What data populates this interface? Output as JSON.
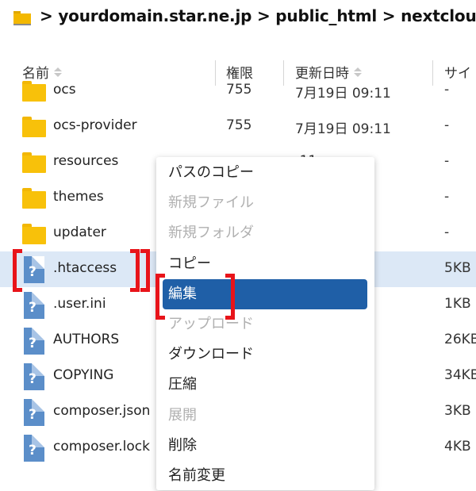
{
  "breadcrumb": {
    "path": "> yourdomain.star.ne.jp > public_html > nextcloud",
    "icon": "folder-icon"
  },
  "columns": {
    "name": "名前",
    "perm": "権限",
    "date": "更新日時",
    "size": "サイ"
  },
  "rows": [
    {
      "name": "ocs",
      "perm": "755",
      "date": "7月19日 09:11",
      "size": "-",
      "type": "folder"
    },
    {
      "name": "ocs-provider",
      "perm": "755",
      "date": "7月19日 09:11",
      "size": "-",
      "type": "folder"
    },
    {
      "name": "resources",
      "perm": "",
      "date": ":11",
      "size": "-",
      "type": "folder"
    },
    {
      "name": "themes",
      "perm": "",
      "date": ":11",
      "size": "-",
      "type": "folder"
    },
    {
      "name": "updater",
      "perm": "",
      "date": ":11",
      "size": "-",
      "type": "folder"
    },
    {
      "name": ".htaccess",
      "perm": "",
      "date": ":54",
      "size": "5KB",
      "type": "file",
      "selected": true
    },
    {
      "name": ".user.ini",
      "perm": "",
      "date": ":54",
      "size": "1KB",
      "type": "file"
    },
    {
      "name": "AUTHORS",
      "perm": "",
      "date": ":54",
      "size": "26KB",
      "type": "file"
    },
    {
      "name": "COPYING",
      "perm": "",
      "date": ":54",
      "size": "34KB",
      "type": "file"
    },
    {
      "name": "composer.json",
      "perm": "",
      "date": ":54",
      "size": "3KB",
      "type": "file"
    },
    {
      "name": "composer.lock",
      "perm": "",
      "date": ":54",
      "size": "4KB",
      "type": "file"
    }
  ],
  "context_menu": [
    {
      "label": "パスのコピー",
      "state": "enabled"
    },
    {
      "label": "新規ファイル",
      "state": "disabled"
    },
    {
      "label": "新規フォルダ",
      "state": "disabled"
    },
    {
      "label": "コピー",
      "state": "enabled"
    },
    {
      "label": "編集",
      "state": "active"
    },
    {
      "label": "アップロード",
      "state": "disabled"
    },
    {
      "label": "ダウンロード",
      "state": "enabled"
    },
    {
      "label": "圧縮",
      "state": "enabled"
    },
    {
      "label": "展開",
      "state": "disabled"
    },
    {
      "label": "削除",
      "state": "enabled"
    },
    {
      "label": "名前変更",
      "state": "enabled"
    }
  ],
  "colors": {
    "selected_row": "#dce8f6",
    "menu_active": "#1f5fa7",
    "highlight_bracket": "#e8141a"
  }
}
